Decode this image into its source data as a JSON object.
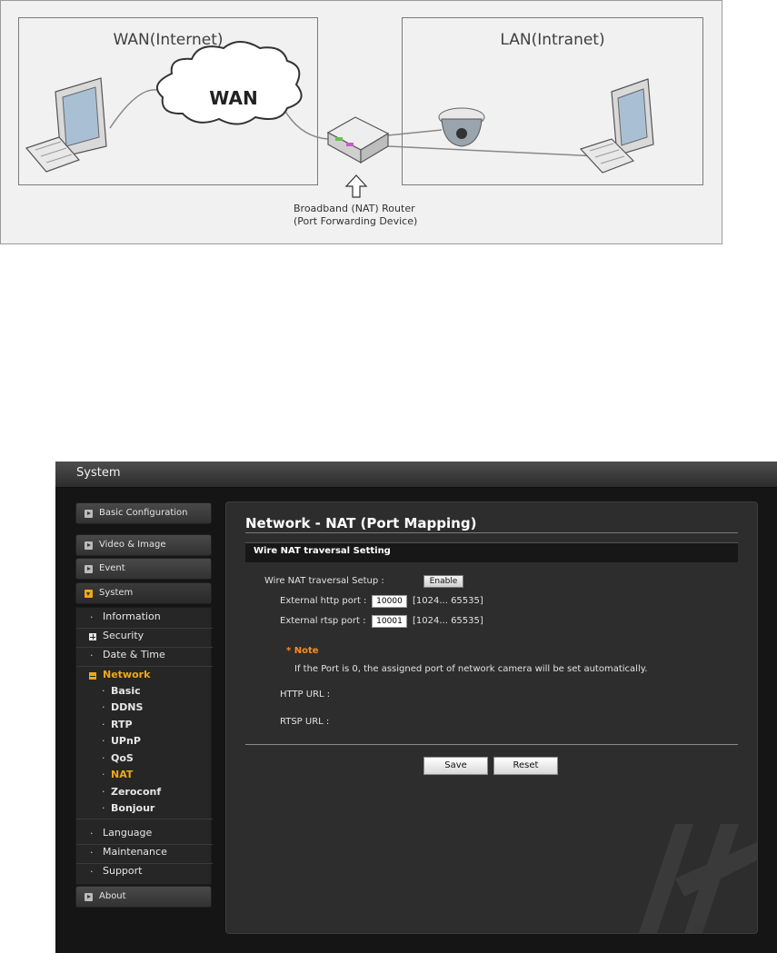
{
  "diagram": {
    "wan_zone_title": "WAN(Internet)",
    "lan_zone_title": "LAN(Intranet)",
    "cloud_label": "WAN",
    "router_caption_line1": "Broadband (NAT) Router",
    "router_caption_line2": "(Port Forwarding Device)"
  },
  "app": {
    "window_title": "System",
    "sidebar": {
      "top_items": {
        "basic_configuration": "Basic Configuration",
        "video_image": "Video & Image",
        "event": "Event",
        "system": "System",
        "about": "About"
      },
      "system_items": {
        "information": "Information",
        "security": "Security",
        "date_time": "Date & Time",
        "network": "Network",
        "language": "Language",
        "maintenance": "Maintenance",
        "support": "Support"
      },
      "network_items": [
        "Basic",
        "DDNS",
        "RTP",
        "UPnP",
        "QoS",
        "NAT",
        "Zeroconf",
        "Bonjour"
      ],
      "active_network_item": "NAT"
    },
    "main": {
      "page_title": "Network - NAT (Port Mapping)",
      "section_title": "Wire NAT traversal Setting",
      "setup_label": "Wire NAT traversal Setup :",
      "enable_button": "Enable",
      "http_port_label": "External http port :",
      "http_port_value": "10000",
      "http_port_range": "[1024... 65535]",
      "rtsp_port_label": "External rtsp port :",
      "rtsp_port_value": "10001",
      "rtsp_port_range": "[1024... 65535]",
      "note_title": "* Note",
      "note_text": "If the Port is 0, the assigned port of network camera will be set automatically.",
      "http_url_label": "HTTP URL :",
      "rtsp_url_label": "RTSP URL :",
      "save_button": "Save",
      "reset_button": "Reset"
    },
    "colors": {
      "accent": "#f0a81a",
      "note": "#ff8a1f"
    }
  }
}
